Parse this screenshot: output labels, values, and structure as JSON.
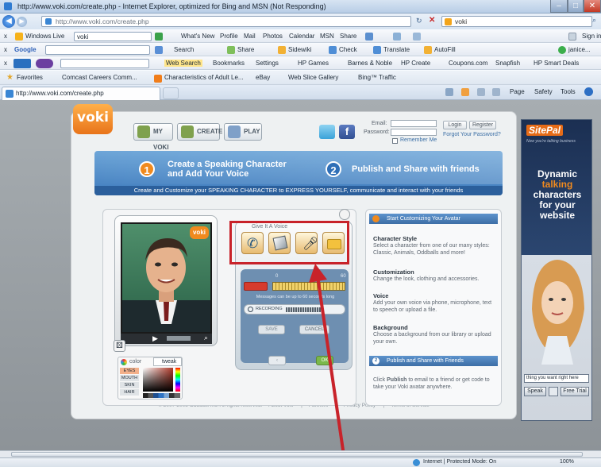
{
  "window": {
    "title": "http://www.voki.com/create.php - Internet Explorer, optimized for Bing and MSN (Not Responding)",
    "search_box": "voki",
    "address": "http://www.voki.com/create.php"
  },
  "toolbar1": {
    "close": "x",
    "brand": "Windows Live",
    "search_value": "voki",
    "items": [
      "What's New",
      "Profile",
      "Mail",
      "Photos",
      "Calendar",
      "MSN",
      "Share"
    ],
    "right": "Sign in"
  },
  "toolbar2": {
    "brand": "Google",
    "items": [
      "Search",
      "Share",
      "Sidewiki",
      "Check",
      "Translate",
      "AutoFill"
    ],
    "right": "janice..."
  },
  "toolbar3": {
    "items": [
      "Web Search",
      "Bookmarks",
      "Settings",
      "HP Games",
      "Barnes & Noble",
      "HP Create",
      "Coupons.com",
      "Snapfish",
      "HP Smart Deals"
    ]
  },
  "favorites": {
    "label": "Favorites",
    "items": [
      "Comcast Careers Comm...",
      "Characteristics of Adult Le...",
      "eBay",
      "Web Slice Gallery",
      "Bing™ Traffic"
    ]
  },
  "tab": {
    "label": "http://www.voki.com/create.php",
    "commands": [
      "Page",
      "Safety",
      "Tools"
    ]
  },
  "voki": {
    "logo": "voki",
    "nav": [
      "MY VOKI",
      "CREATE",
      "PLAY"
    ],
    "login": {
      "email_label": "Email:",
      "password_label": "Password:",
      "remember": "Remember Me",
      "login_btn": "Login",
      "register_btn": "Register",
      "forgot": "Forgot Your Password?"
    },
    "banner": {
      "step1_num": "1",
      "step1_title": "Create a Speaking Character and Add Your Voice",
      "step2_num": "2",
      "step2_title": "Publish and Share with friends",
      "subline": "Create and Customize your SPEAKING CHARACTER to EXPRESS YOURSELF, communicate and interact with your friends"
    },
    "avatar_panel": {
      "badge": "voki",
      "tabs": [
        "color",
        "tweak"
      ],
      "parts": [
        "EYES",
        "MOUTH",
        "SKIN",
        "HAIR"
      ]
    },
    "voice_panel": {
      "title": "Give It A Voice",
      "range_min": "0",
      "range_max": "60",
      "limit_note": "Messages can be up to 60 seconds long",
      "recording_label": "RECORDING",
      "save": "SAVE",
      "cancel": "CANCEL",
      "ok": "OK"
    },
    "right_panel": {
      "start_head": "Start Customizing Your Avatar",
      "sections": [
        {
          "title": "Character Style",
          "text": "Select a character from one of our many styles: Classic, Animals, Oddballs and more!"
        },
        {
          "title": "Customization",
          "text": "Change the look, clothing and accessories."
        },
        {
          "title": "Voice",
          "text": "Add your own voice via phone, microphone, text to speech or upload a file."
        },
        {
          "title": "Background",
          "text": "Choose a background from our library or upload your own."
        }
      ],
      "publish_num": "2",
      "publish_head": "Publish and Share with Friends",
      "publish_text_1": "Click ",
      "publish_text_bold": "Publish",
      "publish_text_2": " to email to a friend or get code to take your Voki avatar anywhere."
    },
    "footer": {
      "copyright": "© 2007-2008 Oddcast Inc. All rights reserved.",
      "links": [
        "About Voki",
        "Partners",
        "Privacy Policy",
        "Terms of Service"
      ]
    }
  },
  "ad": {
    "brand": "SitePal",
    "tagline": "Now you're talking business",
    "line1": "Dynamic",
    "line2": "talking",
    "line3": "characters",
    "line4": "for your",
    "line5": "website",
    "input": "thing you want right here",
    "speak_btn": "Speak",
    "trial_btn": "Free Trial"
  },
  "status": {
    "zone": "Internet | Protected Mode: On",
    "zoom": "100%"
  },
  "colors": {
    "voki_orange": "#f08a1e",
    "voki_blue": "#3f7bbd",
    "highlight_red": "#c8232a",
    "ad_orange": "#e66b17"
  }
}
